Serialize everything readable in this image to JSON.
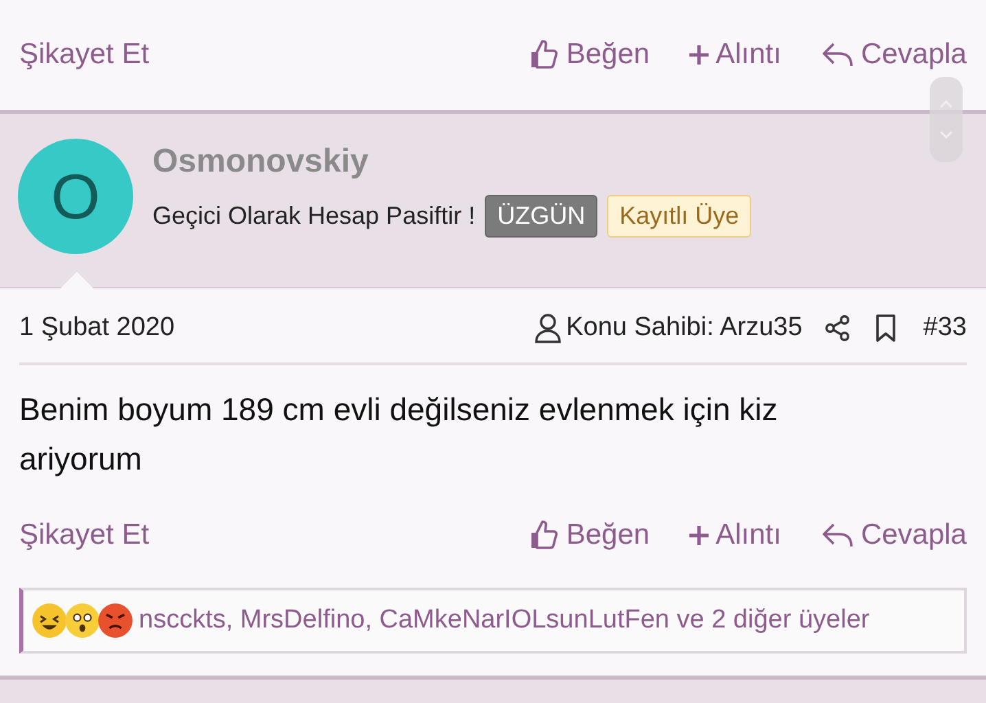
{
  "top_actions": {
    "report": "Şikayet Et",
    "like": "Beğen",
    "quote": "Alıntı",
    "reply": "Cevapla"
  },
  "post": {
    "author": {
      "initial": "O",
      "name": "Osmonovskiy",
      "status": "Geçici Olarak Hesap Pasiftir !",
      "badges": [
        {
          "label": "ÜZGÜN",
          "kind": "dark"
        },
        {
          "label": "Kayıtlı Üye",
          "kind": "member"
        }
      ]
    },
    "date": "1 Şubat 2020",
    "thread_starter": "Konu Sahibi: Arzu35",
    "post_number": "#33",
    "body": "Benim boyum 189 cm evli değilseniz evlenmek için kiz ariyorum",
    "actions": {
      "report": "Şikayet Et",
      "like": "Beğen",
      "quote": "Alıntı",
      "reply": "Cevapla"
    },
    "reactions": {
      "emojis": [
        {
          "kind": "laughing"
        },
        {
          "kind": "shocked"
        },
        {
          "kind": "angry"
        }
      ],
      "text": "nscckts, MrsDelfino, CaMkeNarIOLsunLutFen ve 2 diğer üyeler"
    }
  }
}
